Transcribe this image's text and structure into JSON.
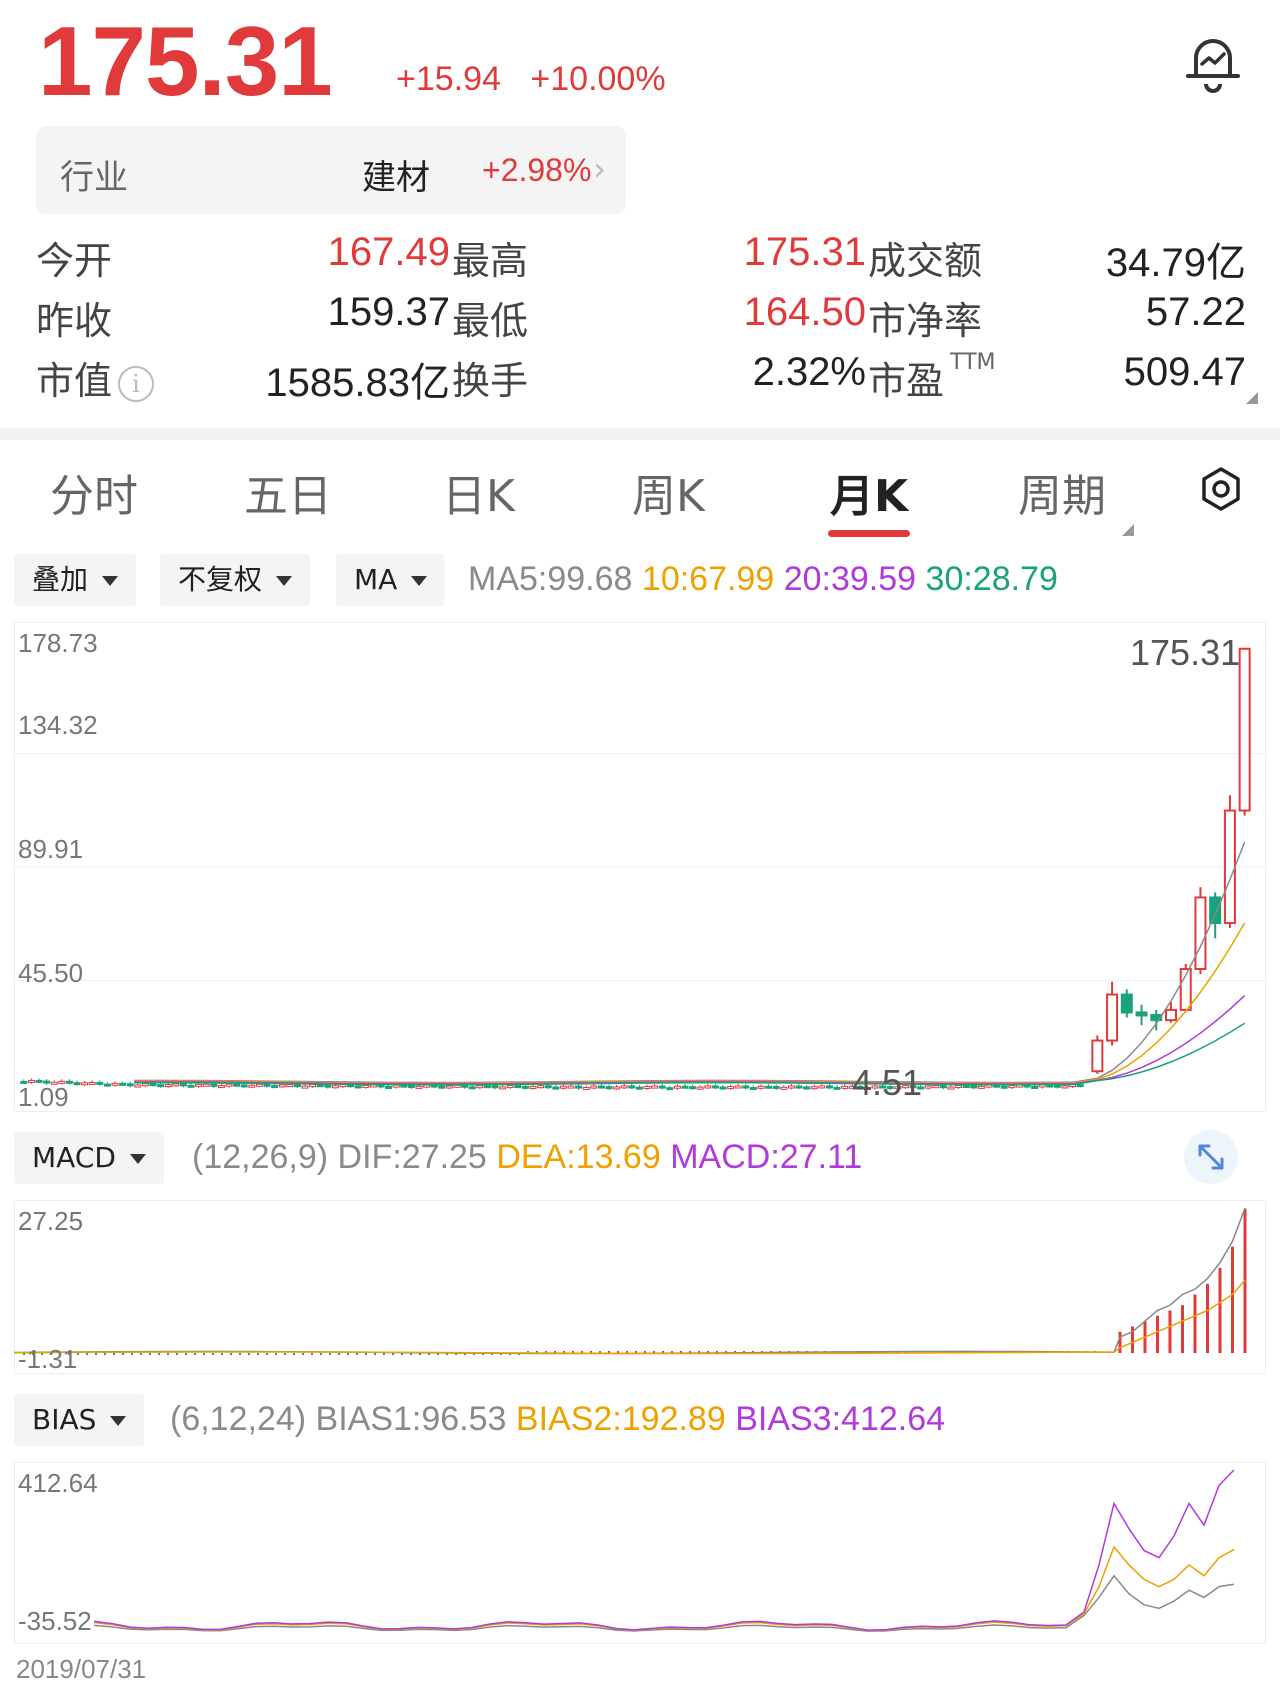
{
  "quote": {
    "price": "175.31",
    "change": "+15.94",
    "change_pct": "+10.00%"
  },
  "industry": {
    "label": "行业",
    "sector": "建材",
    "sector_pct": "+2.98%"
  },
  "stats": [
    {
      "label": "今开",
      "value": "167.49",
      "color": "red"
    },
    {
      "label": "最高",
      "value": "175.31",
      "color": "red"
    },
    {
      "label": "成交额",
      "value": "34.79亿",
      "color": "black"
    },
    {
      "label": "昨收",
      "value": "159.37",
      "color": "black"
    },
    {
      "label": "最低",
      "value": "164.50",
      "color": "red"
    },
    {
      "label": "市净率",
      "value": "57.22",
      "color": "black"
    },
    {
      "label": "市值",
      "value": "1585.83亿",
      "color": "black"
    },
    {
      "label": "换手",
      "value": "2.32%",
      "color": "black"
    },
    {
      "label": "市盈",
      "value": "509.47",
      "color": "black",
      "superscript": "TTM"
    }
  ],
  "tabs": [
    "分时",
    "五日",
    "日K",
    "周K",
    "月K",
    "周期"
  ],
  "active_tab": "月K",
  "controls": {
    "overlay": "叠加",
    "adjust": "不复权",
    "indicator": "MA",
    "macd": "MACD",
    "bias": "BIAS"
  },
  "ma": {
    "ma5": "MA5:99.68",
    "ma10": "10:67.99",
    "ma20": "20:39.59",
    "ma30": "30:28.79"
  },
  "macd": {
    "params": "(12,26,9)",
    "dif": "DIF:27.25",
    "dea": "DEA:13.69",
    "macd": "MACD:27.11"
  },
  "bias": {
    "params": "(6,12,24)",
    "bias1": "BIAS1:96.53",
    "bias2": "BIAS2:192.89",
    "bias3": "BIAS3:412.64"
  },
  "colors": {
    "up": "#e03a3a",
    "down": "#1aa27a",
    "ma5": "#8a8a8a",
    "ma10": "#f0a000",
    "ma20": "#b23adb",
    "ma30": "#1aa27a"
  },
  "chart_data": [
    {
      "type": "candlestick",
      "title": "月K",
      "y_ticks": [
        "178.73",
        "134.32",
        "89.91",
        "45.50",
        "1.09"
      ],
      "ylim": [
        1.09,
        178.73
      ],
      "annotations": {
        "high_label": "175.31",
        "low_label": "4.51"
      },
      "recent_candles": [
        {
          "open": 10,
          "close": 22,
          "high": 24,
          "low": 9
        },
        {
          "open": 22,
          "close": 40,
          "high": 45,
          "low": 20
        },
        {
          "open": 40,
          "close": 33,
          "high": 42,
          "low": 31
        },
        {
          "open": 33,
          "close": 32,
          "high": 36,
          "low": 28
        },
        {
          "open": 32,
          "close": 30,
          "high": 34,
          "low": 26
        },
        {
          "open": 30,
          "close": 34,
          "high": 37,
          "low": 29
        },
        {
          "open": 34,
          "close": 50,
          "high": 52,
          "low": 33
        },
        {
          "open": 50,
          "close": 78,
          "high": 82,
          "low": 48
        },
        {
          "open": 78,
          "close": 68,
          "high": 80,
          "low": 62
        },
        {
          "open": 68,
          "close": 112,
          "high": 118,
          "low": 66
        },
        {
          "open": 112,
          "close": 175.31,
          "high": 175.31,
          "low": 110
        }
      ]
    },
    {
      "type": "bar",
      "title": "MACD",
      "y_ticks": [
        "27.25",
        "-1.31"
      ],
      "ylim": [
        -1.31,
        27.25
      ]
    },
    {
      "type": "line",
      "title": "BIAS",
      "y_ticks": [
        "412.64",
        "-35.52"
      ],
      "ylim": [
        -35.52,
        412.64
      ],
      "x_start_label": "2019/07/31"
    }
  ]
}
